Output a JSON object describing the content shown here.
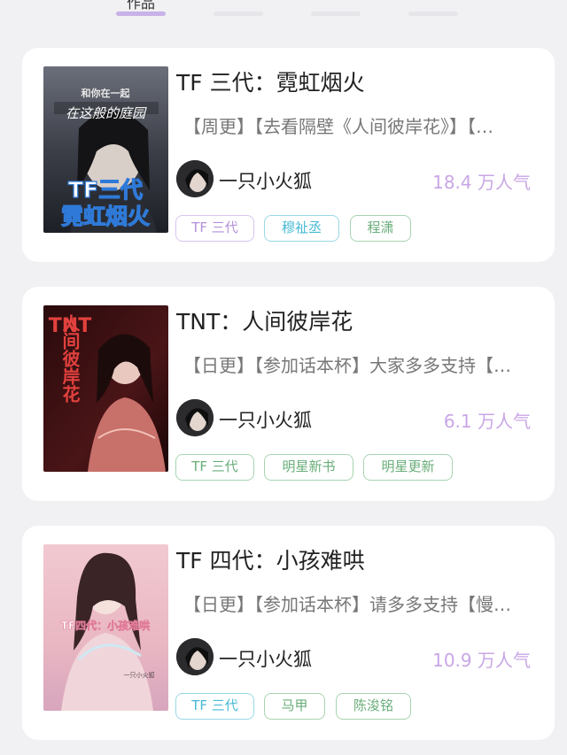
{
  "tabs": [
    {
      "label": "作品",
      "active": true
    },
    {
      "label": "",
      "active": false
    },
    {
      "label": "",
      "active": false
    },
    {
      "label": "",
      "active": false
    }
  ],
  "books": [
    {
      "title": "TF 三代：霓虹烟火",
      "description": "【周更】【去看隔壁《人间彼岸花》】【…",
      "author": "一只小火狐",
      "popularity": "18.4 万人气",
      "cover_title_lines": [
        "TF三代",
        "霓虹烟火"
      ],
      "cover_top_text": [
        "和你在一起",
        "在这般的庭园"
      ],
      "tags": [
        {
          "label": "TF 三代",
          "color": "purple"
        },
        {
          "label": "穆祉丞",
          "color": "teal"
        },
        {
          "label": "程潇",
          "color": "green"
        }
      ]
    },
    {
      "title": "TNT：人间彼岸花",
      "description": "【日更】【参加话本杯】大家多多支持【…",
      "author": "一只小火狐",
      "popularity": "6.1 万人气",
      "cover_title_lines": [
        "TNT",
        "人间彼岸花"
      ],
      "cover_top_text": [],
      "tags": [
        {
          "label": "TF 三代",
          "color": "green"
        },
        {
          "label": "明星新书",
          "color": "green"
        },
        {
          "label": "明星更新",
          "color": "green"
        }
      ]
    },
    {
      "title": "TF 四代：小孩难哄",
      "description": "【日更】【参加话本杯】请多多支持【慢…",
      "author": "一只小火狐",
      "popularity": "10.9 万人气",
      "cover_title_lines": [
        "TF四代：小孩难哄"
      ],
      "cover_top_text": [
        "一只小火狐"
      ],
      "tags": [
        {
          "label": "TF 三代",
          "color": "teal"
        },
        {
          "label": "马甲",
          "color": "green"
        },
        {
          "label": "陈浚铭",
          "color": "green"
        }
      ]
    }
  ],
  "colors": {
    "accent": "#c8b2e8",
    "popularity": "#c9a6e6",
    "background": "#f1f1f4"
  }
}
